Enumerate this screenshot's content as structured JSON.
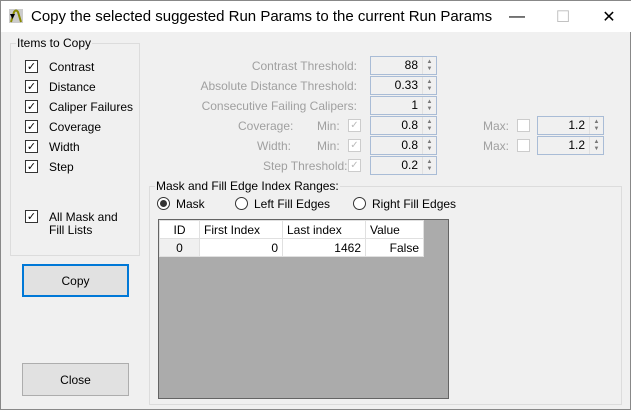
{
  "window": {
    "title": "Copy the selected suggested Run Params to the current Run Params",
    "minimize": "—",
    "maximize": "☐",
    "close": "✕"
  },
  "items_group": {
    "legend": "Items to Copy",
    "items": [
      {
        "label": "Contrast",
        "checked": true
      },
      {
        "label": "Distance",
        "checked": true
      },
      {
        "label": "Caliper Failures",
        "checked": true
      },
      {
        "label": "Coverage",
        "checked": true
      },
      {
        "label": "Width",
        "checked": true
      },
      {
        "label": "Step",
        "checked": true
      }
    ],
    "all_mask": {
      "label_line1": "All Mask and",
      "label_line2": "Fill Lists",
      "checked": true
    }
  },
  "buttons": {
    "copy": "Copy",
    "close": "Close"
  },
  "params": {
    "contrast_label": "Contrast Threshold:",
    "contrast": "88",
    "distance_label": "Absolute Distance Threshold:",
    "distance": "0.33",
    "calipers_label": "Consecutive Failing Calipers:",
    "calipers": "1",
    "coverage_label": "Coverage:",
    "width_label": "Width:",
    "min_label": "Min:",
    "max_label": "Max:",
    "coverage_min": "0.8",
    "coverage_max": "1.2",
    "width_min": "0.8",
    "width_max": "1.2",
    "step_label": "Step Threshold:",
    "step": "0.2"
  },
  "ranges": {
    "legend": "Mask and Fill Edge Index Ranges:",
    "radios": [
      {
        "label": "Mask",
        "selected": true
      },
      {
        "label": "Left Fill Edges",
        "selected": false
      },
      {
        "label": "Right Fill Edges",
        "selected": false
      }
    ],
    "columns": [
      "ID",
      "First Index",
      "Last index",
      "Value"
    ],
    "rows": [
      [
        "0",
        "0",
        "1462",
        "False"
      ]
    ]
  }
}
